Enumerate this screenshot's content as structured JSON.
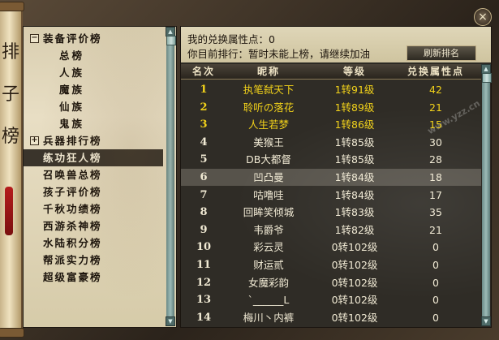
{
  "window": {
    "close_label": "×"
  },
  "scroll_glyphs": [
    "排",
    "子",
    "榜"
  ],
  "watermark": "www.yzz.cn",
  "left_tree": [
    {
      "type": "cat",
      "toggle": "⊟",
      "label": "装备评价榜",
      "selected": false
    },
    {
      "type": "sub",
      "label": "总榜",
      "selected": false
    },
    {
      "type": "sub",
      "label": "人族",
      "selected": false
    },
    {
      "type": "sub",
      "label": "魔族",
      "selected": false
    },
    {
      "type": "sub",
      "label": "仙族",
      "selected": false
    },
    {
      "type": "sub",
      "label": "鬼族",
      "selected": false
    },
    {
      "type": "cat",
      "toggle": "⊞",
      "label": "兵器排行榜",
      "selected": false
    },
    {
      "type": "cat",
      "toggle": "",
      "label": "练功狂人榜",
      "selected": true
    },
    {
      "type": "cat",
      "toggle": "",
      "label": "召唤兽总榜",
      "selected": false
    },
    {
      "type": "cat",
      "toggle": "",
      "label": "孩子评价榜",
      "selected": false
    },
    {
      "type": "cat",
      "toggle": "",
      "label": "千秋功绩榜",
      "selected": false
    },
    {
      "type": "cat",
      "toggle": "",
      "label": "西游杀神榜",
      "selected": false
    },
    {
      "type": "cat",
      "toggle": "",
      "label": "水陆积分榜",
      "selected": false
    },
    {
      "type": "cat",
      "toggle": "",
      "label": "帮派实力榜",
      "selected": false
    },
    {
      "type": "cat",
      "toggle": "",
      "label": "超级富豪榜",
      "selected": false
    }
  ],
  "info": {
    "my_points": "我的兑换属性点：0",
    "my_rank": "你目前排行：暂时未能上榜，请继续加油",
    "refresh_label": "刷新排名"
  },
  "table": {
    "headers": [
      "名次",
      "昵称",
      "等级",
      "兑换属性点"
    ],
    "rows": [
      {
        "rank": "1",
        "name": "执笔弑天下",
        "grade": "1转91级",
        "points": "42",
        "gold": true,
        "selected": false
      },
      {
        "rank": "2",
        "name": "聆听の落花",
        "grade": "1转89级",
        "points": "21",
        "gold": true,
        "selected": false
      },
      {
        "rank": "3",
        "name": "人生若梦",
        "grade": "1转86级",
        "points": "15",
        "gold": true,
        "selected": false
      },
      {
        "rank": "4",
        "name": "美猴王",
        "grade": "1转85级",
        "points": "30",
        "gold": false,
        "selected": false
      },
      {
        "rank": "5",
        "name": "DB大都督",
        "grade": "1转85级",
        "points": "28",
        "gold": false,
        "selected": false
      },
      {
        "rank": "6",
        "name": "凹凸曼",
        "grade": "1转84级",
        "points": "18",
        "gold": false,
        "selected": true
      },
      {
        "rank": "7",
        "name": "咕噜哇",
        "grade": "1转84级",
        "points": "17",
        "gold": false,
        "selected": false
      },
      {
        "rank": "8",
        "name": "回眸笑倾城",
        "grade": "1转83级",
        "points": "35",
        "gold": false,
        "selected": false
      },
      {
        "rank": "9",
        "name": "韦爵爷",
        "grade": "1转82级",
        "points": "21",
        "gold": false,
        "selected": false
      },
      {
        "rank": "10",
        "name": "彩云灵",
        "grade": "0转102级",
        "points": "0",
        "gold": false,
        "selected": false
      },
      {
        "rank": "11",
        "name": "财运贰",
        "grade": "0转102级",
        "points": "0",
        "gold": false,
        "selected": false
      },
      {
        "rank": "12",
        "name": "女魔彩韵",
        "grade": "0转102级",
        "points": "0",
        "gold": false,
        "selected": false
      },
      {
        "rank": "13",
        "name": "`______L",
        "grade": "0转102级",
        "points": "0",
        "gold": false,
        "selected": false
      },
      {
        "rank": "14",
        "name": "梅川丶内裤",
        "grade": "0转102级",
        "points": "0",
        "gold": false,
        "selected": false
      }
    ]
  },
  "icons": {
    "scroll_up": "▲",
    "scroll_down": "▼"
  }
}
